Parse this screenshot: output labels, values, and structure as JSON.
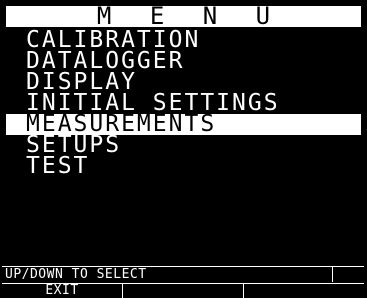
{
  "menu": {
    "title": "M E N U",
    "items": [
      {
        "label": "CALIBRATION",
        "selected": false
      },
      {
        "label": "DATALOGGER",
        "selected": false
      },
      {
        "label": "DISPLAY",
        "selected": false
      },
      {
        "label": "INITIAL SETTINGS",
        "selected": false
      },
      {
        "label": "MEASUREMENTS",
        "selected": true
      },
      {
        "label": "SETUPS",
        "selected": false
      },
      {
        "label": "TEST",
        "selected": false
      }
    ]
  },
  "status": {
    "text": "UP/DOWN TO SELECT"
  },
  "softkeys": [
    {
      "label": "EXIT"
    },
    {
      "label": ""
    },
    {
      "label": ""
    }
  ],
  "colors": {
    "background": "#000000",
    "foreground": "#ffffff",
    "highlight": "#ffffff"
  }
}
